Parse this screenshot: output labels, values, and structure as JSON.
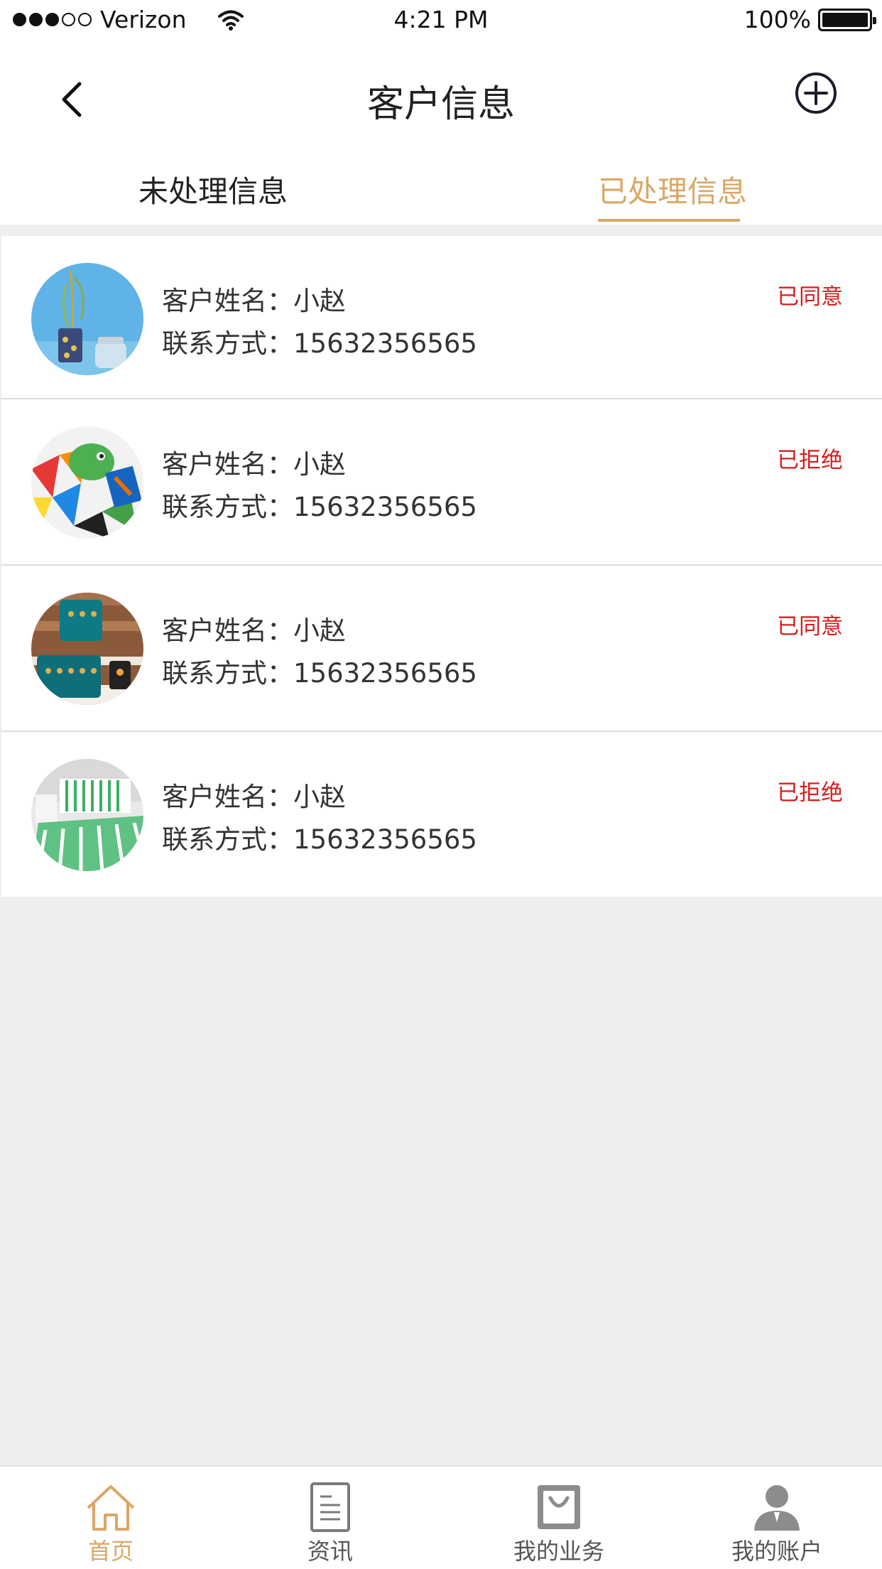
{
  "status_bar": {
    "carrier": "Verizon",
    "time": "4:21 PM",
    "battery": "100%",
    "signal_filled": 3,
    "signal_total": 5
  },
  "nav": {
    "title": "客户信息",
    "back_icon": "chevron-left-icon",
    "add_icon": "plus-circle-icon"
  },
  "tabs": {
    "unprocessed": "未处理信息",
    "processed": "已处理信息",
    "active": "processed"
  },
  "customers": [
    {
      "name_label": "客户姓名：小赵",
      "phone_label": "联系方式：15632356565",
      "status": "已同意"
    },
    {
      "name_label": "客户姓名：小赵",
      "phone_label": "联系方式：15632356565",
      "status": "已拒绝"
    },
    {
      "name_label": "客户姓名：小赵",
      "phone_label": "联系方式：15632356565",
      "status": "已同意"
    },
    {
      "name_label": "客户姓名：小赵",
      "phone_label": "联系方式：15632356565",
      "status": "已拒绝"
    }
  ],
  "tabbar": {
    "items": [
      {
        "label": "首页",
        "icon": "home-icon",
        "active": true
      },
      {
        "label": "资讯",
        "icon": "document-icon",
        "active": false
      },
      {
        "label": "我的业务",
        "icon": "shopping-bag-icon",
        "active": false
      },
      {
        "label": "我的账户",
        "icon": "user-icon",
        "active": false
      }
    ]
  },
  "colors": {
    "accent": "#dba765",
    "status_red": "#d81d1d",
    "background": "#eeeeee"
  }
}
